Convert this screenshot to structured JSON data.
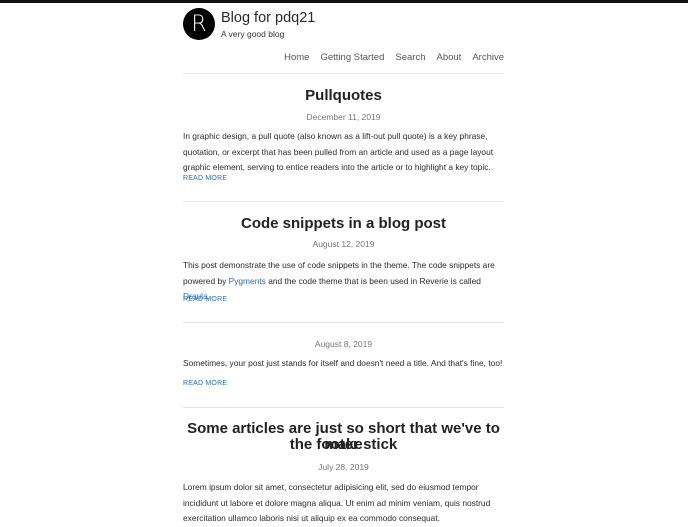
{
  "header": {
    "logo_letter": "R",
    "site_title": "Blog for pdq21",
    "tagline": "A very good blog"
  },
  "nav": {
    "items": [
      "Home",
      "Getting Started",
      "Search",
      "About",
      "Archive"
    ]
  },
  "posts": [
    {
      "title": "Pullquotes",
      "date": "December 11, 2019",
      "body": "In graphic design, a pull quote (also known as a lift-out pull quote) is a key phrase, quotation, or excerpt that has been pulled from an article and used as a page layout graphic element, serving to entice readers into the article or to highlight a key topic.",
      "read_more": "READ MORE"
    },
    {
      "title": "Code snippets in a blog post",
      "date": "August 12, 2019",
      "body_parts": [
        "This post demonstrate the use of code snippets in the theme. The code snippets are powered by ",
        "Pygments",
        " and the code theme that is been used in Reverie is called ",
        "Draula",
        "."
      ],
      "read_more": "READ MORE"
    },
    {
      "title": "",
      "date": "August 8, 2019",
      "body": "Sometimes, your post just stands for itself and doesn't need a title. And that's fine, too!",
      "read_more": "READ MORE"
    },
    {
      "title_line1": "Some articles are just so short that we've to make",
      "title_line2": "the footer stick",
      "date": "July 28, 2019",
      "body": "Lorem ipsum dolor sit amet, consectetur adipisicing elit, sed do eiusmod tempor incididunt ut labore et dolore magna aliqua. Ut enim ad minim veniam, quis nostrud exercitation ullamco laboris nisi ut aliquip ex ea commodo consequat."
    }
  ],
  "colors": {
    "link": "#2a6db8",
    "rule": "#e6e6e6",
    "top_bar": "#111111"
  }
}
